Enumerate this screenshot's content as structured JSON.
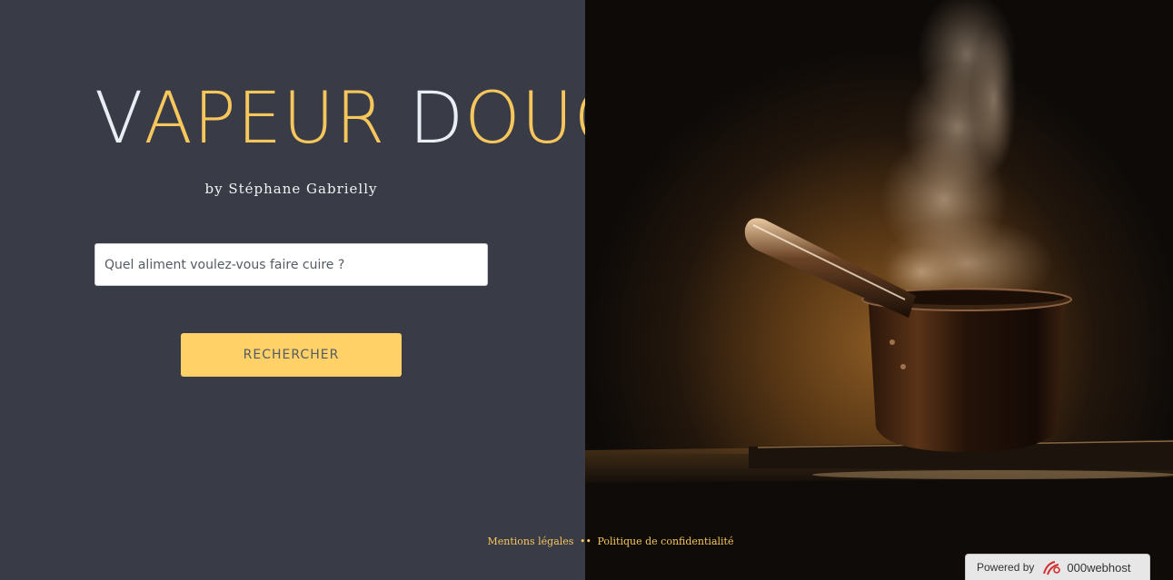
{
  "brand": {
    "title_v": "V",
    "title_apeur": "APEUR",
    "title_d": "D",
    "title_ouce": "OUCE",
    "subtitle": "by Stéphane Gabrielly"
  },
  "search": {
    "placeholder": "Quel aliment voulez-vous faire cuire ?",
    "value": "",
    "button_label": "RECHERCHER"
  },
  "footer": {
    "legal_link": "Mentions légales",
    "separator": "••",
    "privacy_link": "Politique de confidentialité"
  },
  "badge": {
    "powered_text": "Powered by",
    "host_name": "000webhost",
    "logo_icon": "000webhost-logo-icon"
  },
  "colors": {
    "panel_bg": "#393c47",
    "accent": "#f7c75c",
    "button_bg": "#ffd166",
    "pale_letter": "#e9eef5"
  },
  "hero_image": {
    "icon": "steaming-saucepan-photo"
  }
}
